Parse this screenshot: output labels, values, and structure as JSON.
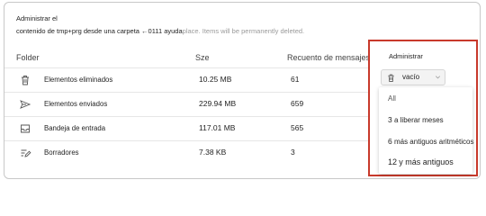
{
  "description": {
    "line1": "Administrar el",
    "line2": "contenido de tmp+prg desde una carpeta ←0111 ayuda",
    "tail": "place. Items will be permanently deleted."
  },
  "columns": {
    "folder": "Folder",
    "size": "Sze",
    "count": "Recuento de mensajes"
  },
  "rows": [
    {
      "icon": "trash-icon",
      "name": "Elementos eliminados",
      "size": "10.25 MB",
      "count": "61"
    },
    {
      "icon": "send-icon",
      "name": "Elementos enviados",
      "size": "229.94 MB",
      "count": "659"
    },
    {
      "icon": "inbox-icon",
      "name": "Bandeja de entrada",
      "size": "117.01 MB",
      "count": "565"
    },
    {
      "icon": "draft-icon",
      "name": "Borradores",
      "size": "7.38 KB",
      "count": "3"
    }
  ],
  "manage": {
    "title": "Administrar",
    "selected": "vacío",
    "options": [
      {
        "num": "",
        "label": "All"
      },
      {
        "num": "3",
        "label": "a liberar meses"
      },
      {
        "num": "6",
        "label": "más antiguos aritméticos"
      },
      {
        "num": "12",
        "label": "y más antiguos"
      }
    ]
  },
  "colors": {
    "highlight": "#c8392b"
  }
}
